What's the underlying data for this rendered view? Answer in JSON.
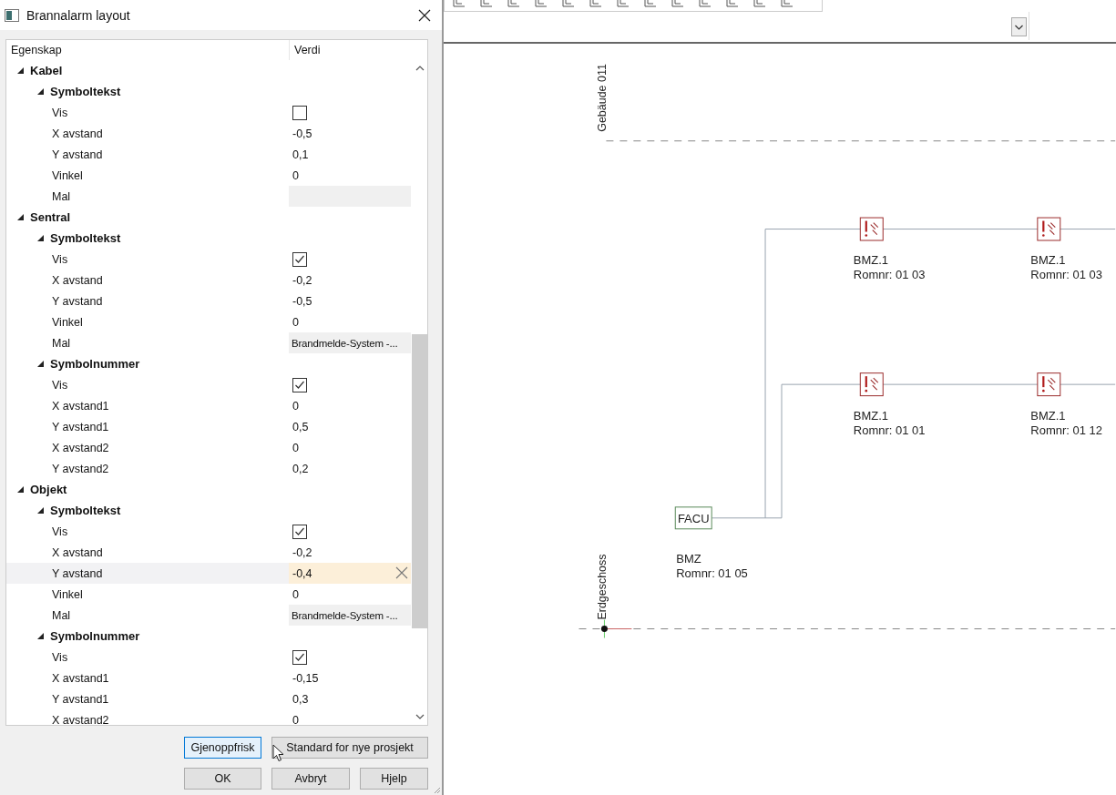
{
  "dialog": {
    "title": "Brannalarm layout",
    "grid": {
      "columns": [
        "Egenskap",
        "Verdi"
      ],
      "categories": [
        {
          "label": "Kabel",
          "expanded": true,
          "children": [
            {
              "label": "Symboltekst",
              "expanded": true,
              "children": [
                {
                  "label": "Vis",
                  "kind": "checkbox",
                  "checked": false,
                  "selected": false
                },
                {
                  "label": "X avstand",
                  "kind": "text",
                  "value": "-0,5",
                  "selected": false
                },
                {
                  "label": "Y avstand",
                  "kind": "text",
                  "value": "0,1",
                  "selected": false
                },
                {
                  "label": "Vinkel",
                  "kind": "text",
                  "value": "0",
                  "selected": false
                },
                {
                  "label": "Mal",
                  "kind": "template",
                  "selected": false
                }
              ]
            }
          ]
        },
        {
          "label": "Sentral",
          "expanded": true,
          "children": [
            {
              "label": "Symboltekst",
              "expanded": true,
              "children": [
                {
                  "label": "Vis",
                  "kind": "checkbox",
                  "checked": true,
                  "selected": false
                },
                {
                  "label": "X avstand",
                  "kind": "text",
                  "value": "-0,2",
                  "selected": false
                },
                {
                  "label": "Y avstand",
                  "kind": "text",
                  "value": "-0,5",
                  "selected": false
                },
                {
                  "label": "Vinkel",
                  "kind": "text",
                  "value": "0",
                  "selected": false
                },
                {
                  "label": "Mal",
                  "kind": "template",
                  "value": "Brandmelde-System -...",
                  "selected": false
                }
              ]
            },
            {
              "label": "Symbolnummer",
              "expanded": true,
              "children": [
                {
                  "label": "Vis",
                  "kind": "checkbox",
                  "checked": true,
                  "selected": false
                },
                {
                  "label": "X avstand1",
                  "kind": "text",
                  "value": "0",
                  "selected": false
                },
                {
                  "label": "Y avstand1",
                  "kind": "text",
                  "value": "0,5",
                  "selected": false
                },
                {
                  "label": "X avstand2",
                  "kind": "text",
                  "value": "0",
                  "selected": false
                },
                {
                  "label": "Y avstand2",
                  "kind": "text",
                  "value": "0,2",
                  "selected": false
                }
              ]
            }
          ]
        },
        {
          "label": "Objekt",
          "expanded": true,
          "children": [
            {
              "label": "Symboltekst",
              "expanded": true,
              "children": [
                {
                  "label": "Vis",
                  "kind": "checkbox",
                  "checked": true,
                  "selected": false
                },
                {
                  "label": "X avstand",
                  "kind": "text",
                  "value": "-0,2",
                  "selected": false
                },
                {
                  "label": "Y avstand",
                  "kind": "text",
                  "value": "-0,4",
                  "selected": true
                },
                {
                  "label": "Vinkel",
                  "kind": "text",
                  "value": "0",
                  "selected": false
                },
                {
                  "label": "Mal",
                  "kind": "template",
                  "value": "Brandmelde-System -...",
                  "selected": false
                }
              ]
            },
            {
              "label": "Symbolnummer",
              "expanded": true,
              "children": [
                {
                  "label": "Vis",
                  "kind": "checkbox",
                  "checked": true,
                  "selected": false
                },
                {
                  "label": "X avstand1",
                  "kind": "text",
                  "value": "-0,15",
                  "selected": false
                },
                {
                  "label": "Y avstand1",
                  "kind": "text",
                  "value": "0,3",
                  "selected": false
                },
                {
                  "label": "X avstand2",
                  "kind": "text",
                  "value": "0",
                  "selected": false
                }
              ]
            }
          ]
        }
      ]
    },
    "buttons": [
      [
        {
          "label": "Gjenoppfrisk",
          "focused": true
        },
        {
          "label": "Standard for nye prosjekt",
          "focused": false
        }
      ],
      [
        {
          "label": "OK",
          "focused": false
        },
        {
          "label": "Avbryt",
          "focused": false
        },
        {
          "label": "Hjelp",
          "focused": false
        }
      ]
    ]
  },
  "diagram": {
    "levels": [
      {
        "name": "Gebäude 011"
      },
      {
        "name": "Erdgeschoss"
      }
    ],
    "control_unit": {
      "symbol": "FACU",
      "name": "BMZ",
      "room": "Romnr: 01 05"
    },
    "devices": [
      {
        "name": "BMZ.1",
        "room": "Romnr: 01 03"
      },
      {
        "name": "BMZ.1",
        "room": "Romnr: 01 03"
      },
      {
        "name": "BMZ.1",
        "room": "Romnr: 01 01"
      },
      {
        "name": "BMZ.1",
        "room": "Romnr: 01 12"
      }
    ]
  }
}
